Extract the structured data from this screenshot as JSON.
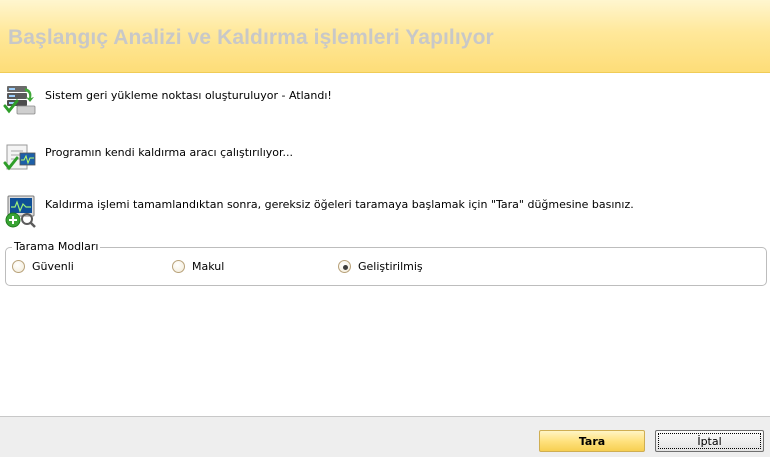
{
  "header": {
    "title": "Başlangıç Analizi ve Kaldırma işlemleri Yapılıyor"
  },
  "steps": [
    {
      "icon": "server-restore-check-icon",
      "text": "Sistem geri yükleme noktası oluşturuluyor - Atlandı!"
    },
    {
      "icon": "document-check-icon",
      "text": "Programın kendi kaldırma aracı çalıştırılıyor..."
    },
    {
      "icon": "monitor-scan-icon",
      "text": "Kaldırma işlemi tamamlandıktan sonra, gereksiz öğeleri taramaya başlamak için \"Tara\" düğmesine basınız."
    }
  ],
  "scan_modes": {
    "legend": "Tarama Modları",
    "options": [
      {
        "label": "Güvenli",
        "selected": false
      },
      {
        "label": "Makul",
        "selected": false
      },
      {
        "label": "Geliştirilmiş",
        "selected": true
      }
    ]
  },
  "buttons": {
    "scan": "Tara",
    "cancel": "İptal"
  },
  "colors": {
    "header_top": "#fff6cf",
    "header_bottom": "#fddd78",
    "title_text": "#c8c8c8",
    "scan_button": "#ffe27f"
  }
}
